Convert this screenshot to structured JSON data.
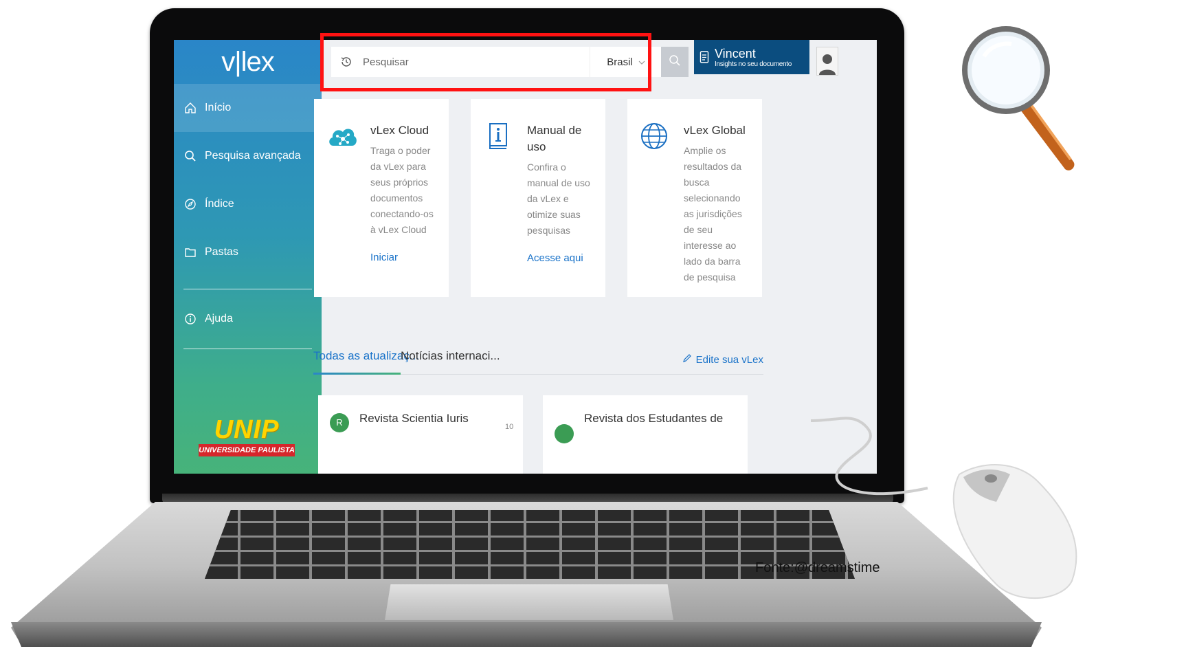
{
  "app": {
    "brand": "v|lex"
  },
  "sidebar": {
    "items": [
      {
        "label": "Início",
        "icon": "home-icon"
      },
      {
        "label": "Pesquisa avançada",
        "icon": "search-icon"
      },
      {
        "label": "Índice",
        "icon": "compass-icon"
      },
      {
        "label": "Pastas",
        "icon": "folder-icon"
      },
      {
        "label": "Ajuda",
        "icon": "info-icon"
      }
    ],
    "logo_word": "UNIP",
    "logo_sub": "UNIVERSIDADE PAULISTA"
  },
  "search": {
    "placeholder": "Pesquisar",
    "jurisdiction": "Brasil",
    "history_icon": "history-icon",
    "button_icon": "search-icon"
  },
  "user": {
    "name": "Vincent",
    "subtitle": "Insights no seu documento",
    "icon": "document-icon"
  },
  "cards": [
    {
      "title": "vLex Cloud",
      "text": "Traga o poder da vLex para seus próprios documentos conectando-os à vLex Cloud",
      "link": "Iniciar",
      "icon": "cloud-network-icon"
    },
    {
      "title": "Manual de uso",
      "text": "Confira o manual de uso da vLex e otimize suas pesquisas",
      "link": "Acesse aqui",
      "icon": "manual-icon"
    },
    {
      "title": "vLex Global",
      "text": "Amplie os resultados da busca selecionando as jurisdições de seu interesse ao lado da barra de pesquisa",
      "icon": "globe-icon"
    }
  ],
  "updates": {
    "tabs": [
      "Todas as atualizaç...",
      "Notícias internaci..."
    ],
    "edit_link": "Edite sua vLex",
    "items": [
      {
        "initial": "R",
        "title": "Revista Scientia Iuris",
        "meta": "10"
      },
      {
        "initial": "",
        "title": "Revista dos Estudantes de"
      }
    ]
  },
  "caption": "Fonte:@dreamstime",
  "colors": {
    "highlight": "#ff1212",
    "accent": "#1a73c9",
    "user_box": "#0b4d7f"
  }
}
